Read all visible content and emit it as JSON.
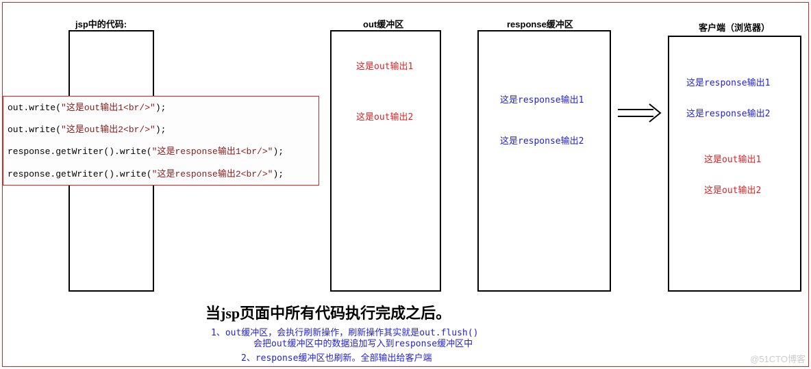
{
  "titles": {
    "jsp": "jsp中的代码:",
    "out_buf": "out缓冲区",
    "resp_buf": "response缓冲区",
    "client": "客户端（浏览器）"
  },
  "code": {
    "l1a": "out.write(",
    "l1s": "\"这是out输出1<br/>\"",
    "l1b": ");",
    "l2a": "out.write(",
    "l2s": "\"这是out输出2<br/>\"",
    "l2b": ");",
    "l3a": "response.getWriter().write(",
    "l3s": "\"这是response输出1<br/>\"",
    "l3b": ");",
    "l4a": "response.getWriter().write(",
    "l4s": "\"这是response输出2<br/>\"",
    "l4b": ");"
  },
  "out_buffer": {
    "line1": "这是out输出1",
    "line2": "这是out输出2"
  },
  "resp_buffer": {
    "line1": "这是response输出1",
    "line2": "这是response输出2"
  },
  "client": {
    "line1": "这是response输出1",
    "line2": "这是response输出2",
    "line3": "这是out输出1",
    "line4": "这是out输出2"
  },
  "heading": "当jsp页面中所有代码执行完成之后。",
  "notes": {
    "n1a": "1、out缓冲区，会执行刷新操作，刷新操作其实就是out.flush()",
    "n1b": "会把out缓冲区中的数据追加写入到response缓冲区中",
    "n2": "2、response缓冲区也刷新。全部输出给客户端"
  },
  "watermark": "@51CTO博客"
}
